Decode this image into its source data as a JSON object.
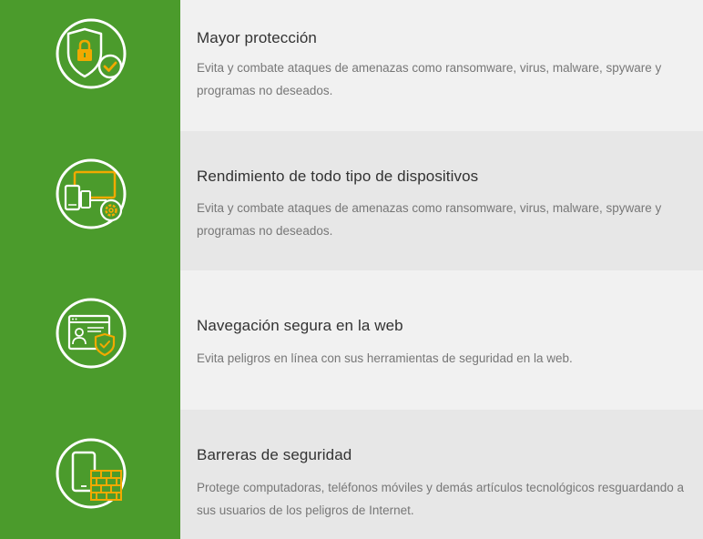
{
  "features": [
    {
      "title": "Mayor protección",
      "description": "Evita y combate ataques de amenazas como ransomware, virus, malware, spyware y programas no deseados.",
      "icon": "shield-lock-check-icon"
    },
    {
      "title": "Rendimiento de todo tipo de dispositivos",
      "description": "Evita y combate ataques de amenazas como ransomware, virus, malware, spyware y programas no deseados.",
      "icon": "devices-gear-icon"
    },
    {
      "title": "Navegación segura en la web",
      "description": "Evita peligros en línea con sus herramientas de seguridad en la web.",
      "icon": "browser-user-shield-icon"
    },
    {
      "title": "Barreras de seguridad",
      "description": "Protege computadoras,  teléfonos móviles y demás artículos tecnológicos resguardando a sus usuarios de los peligros de Internet.",
      "icon": "phone-firewall-icon"
    }
  ],
  "colors": {
    "green": "#4b9b2c",
    "accent": "#f2a900",
    "light_row": "#f1f1f1",
    "dark_row": "#e7e7e7"
  }
}
